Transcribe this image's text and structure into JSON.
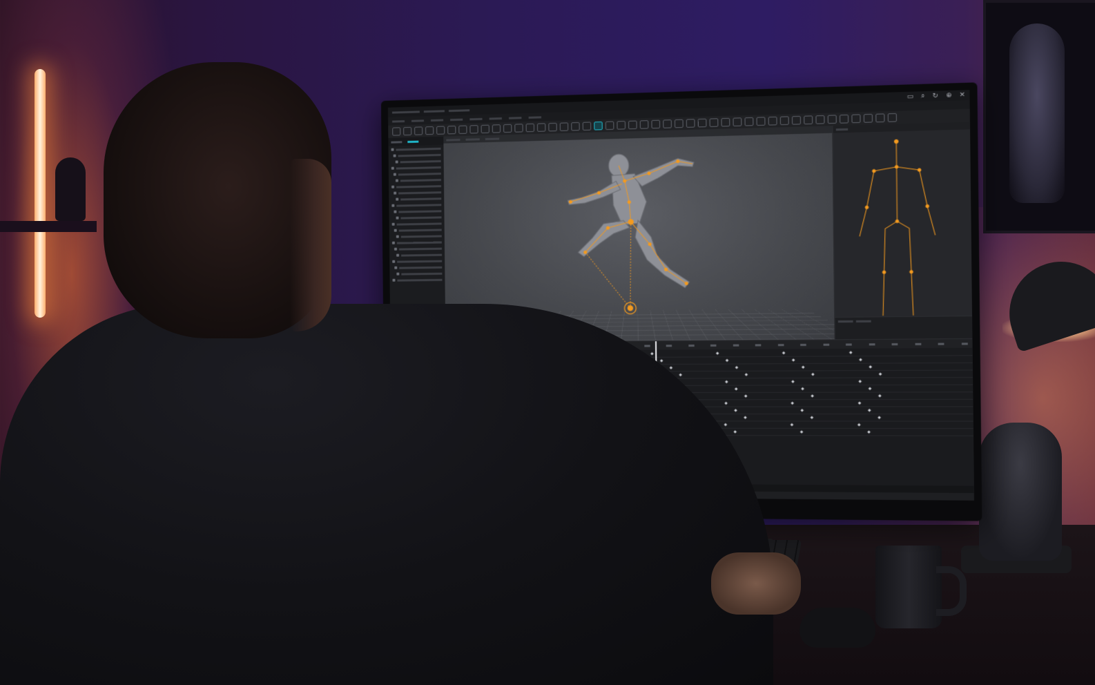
{
  "scene": {
    "description_colors": {
      "wall": "#2b1a55",
      "warm_light": "#ff8a3c",
      "rig_accent": "#f39a1f",
      "ui_accent": "#1fb6c9"
    }
  },
  "app": {
    "window_controls": [
      "minimize",
      "maximize",
      "close"
    ],
    "close_glyph": "✕",
    "toolbar_icons": [
      "select-icon",
      "move-icon",
      "rotate-icon",
      "scale-icon",
      "rig-icon",
      "keyframe-icon",
      "bone-icon",
      "camera-icon",
      "light-icon",
      "render-icon"
    ],
    "viewport": {
      "model": "humanoid-rig",
      "joint_color": "#f39a1f"
    },
    "timeline": {
      "track_colors": [
        "#3a6fb6",
        "#3a6fb6",
        "#a13a36",
        "#2f8a45"
      ],
      "playhead_position": 0.41
    }
  }
}
